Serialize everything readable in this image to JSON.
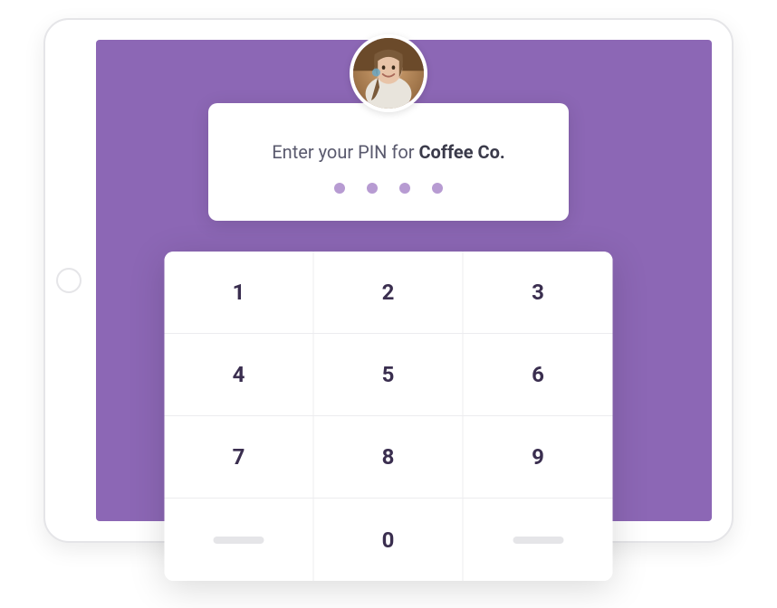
{
  "prompt": {
    "prefix": "Enter your PIN for ",
    "company": "Coffee Co."
  },
  "pin_length": 4,
  "keypad": {
    "keys": [
      "1",
      "2",
      "3",
      "4",
      "5",
      "6",
      "7",
      "8",
      "9",
      "",
      "0",
      ""
    ]
  }
}
